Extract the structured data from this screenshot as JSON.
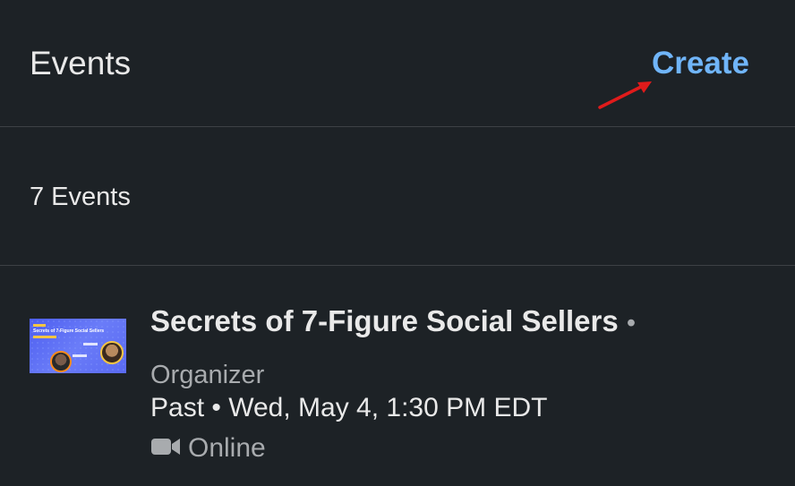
{
  "header": {
    "title": "Events",
    "create_label": "Create"
  },
  "events_count_label": "7 Events",
  "events": [
    {
      "thumbnail": {
        "title": "Secrets of 7-Figure Social Sellers"
      },
      "title": "Secrets of 7-Figure Social Sellers",
      "separator": "•",
      "role": "Organizer",
      "time": "Past • Wed, May 4, 1:30 PM EDT",
      "location_icon": "video-camera-icon",
      "location": "Online"
    }
  ],
  "colors": {
    "background": "#1d2226",
    "accent": "#70b5f9",
    "muted_text": "#a8abae",
    "annotation_arrow": "#e01b1b"
  }
}
